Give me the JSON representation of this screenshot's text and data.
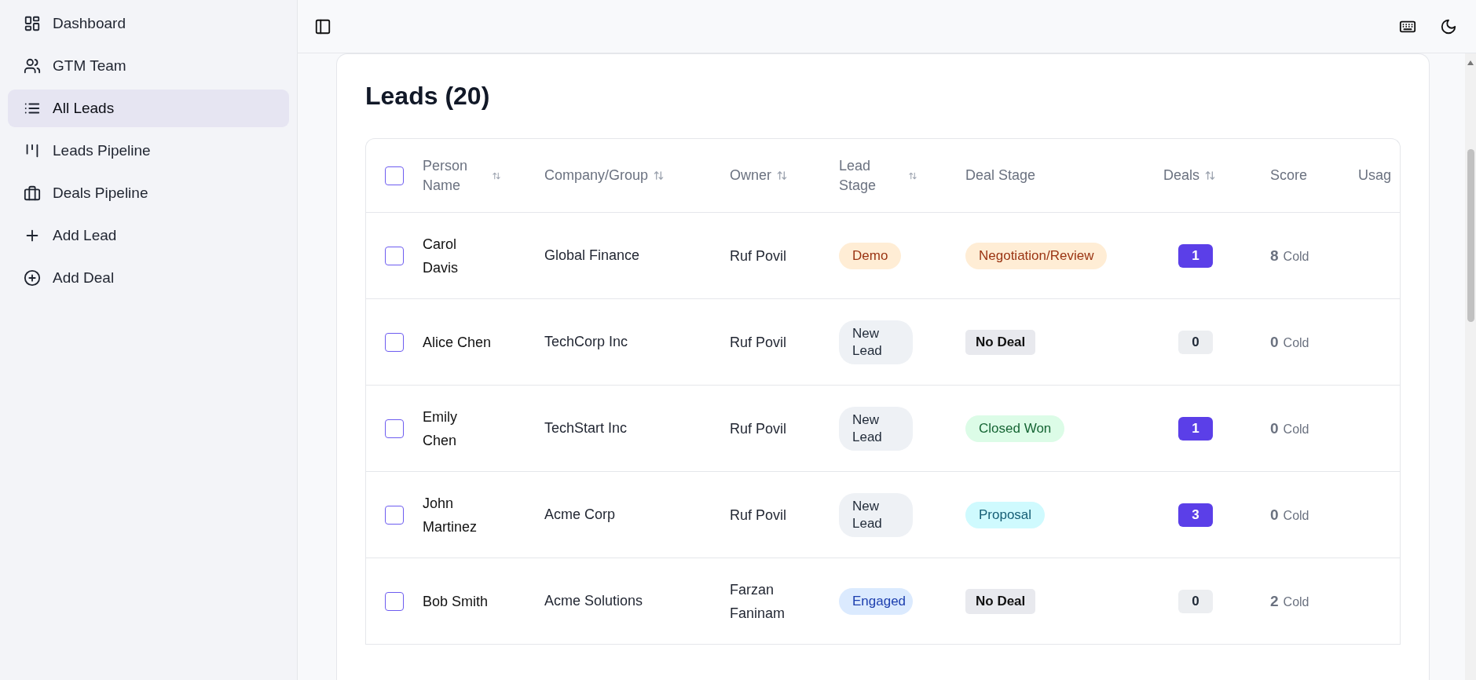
{
  "sidebar": {
    "items": [
      {
        "label": "Dashboard",
        "selected": false
      },
      {
        "label": "GTM Team",
        "selected": false
      },
      {
        "label": "All Leads",
        "selected": true
      },
      {
        "label": "Leads Pipeline",
        "selected": false
      },
      {
        "label": "Deals Pipeline",
        "selected": false
      },
      {
        "label": "Add Lead",
        "selected": false
      },
      {
        "label": "Add Deal",
        "selected": false
      }
    ]
  },
  "card": {
    "title": "Leads (20)"
  },
  "table": {
    "select_all_checked": false,
    "columns": [
      {
        "label": "Person Name",
        "sortable": true
      },
      {
        "label": "Company/Group",
        "sortable": true
      },
      {
        "label": "Owner",
        "sortable": true
      },
      {
        "label": "Lead Stage",
        "sortable": true
      },
      {
        "label": "Deal Stage",
        "sortable": false
      },
      {
        "label": "Deals",
        "sortable": true
      },
      {
        "label": "Score",
        "sortable": false
      },
      {
        "label": "Usag",
        "sortable": false
      }
    ],
    "rows": [
      {
        "checked": false,
        "name": "Carol Davis",
        "company": "Global Finance",
        "owner": "Ruf Povil",
        "lead_stage": {
          "label": "Demo",
          "color": "#ffedd5"
        },
        "deal_stage": {
          "label": "Negotiation/Review",
          "color": "#ffedd5"
        },
        "deals": {
          "label": "1",
          "color": "#5b3fe8"
        },
        "score": "8",
        "temperature": "Cold"
      },
      {
        "checked": false,
        "name": "Alice Chen",
        "company": "TechCorp Inc",
        "owner": "Ruf Povil",
        "lead_stage": {
          "label": "New Lead",
          "color": "#eef1f5"
        },
        "deal_stage": {
          "label": "No Deal",
          "color": "#e8e9ee"
        },
        "deals": {
          "label": "0",
          "color": "#eceef1"
        },
        "score": "0",
        "temperature": "Cold"
      },
      {
        "checked": false,
        "name": "Emily Chen",
        "company": "TechStart Inc",
        "owner": "Ruf Povil",
        "lead_stage": {
          "label": "New Lead",
          "color": "#eef1f5"
        },
        "deal_stage": {
          "label": "Closed Won",
          "color": "#dcfce7"
        },
        "deals": {
          "label": "1",
          "color": "#5b3fe8"
        },
        "score": "0",
        "temperature": "Cold"
      },
      {
        "checked": false,
        "name": "John Martinez",
        "company": "Acme Corp",
        "owner": "Ruf Povil",
        "lead_stage": {
          "label": "New Lead",
          "color": "#eef1f5"
        },
        "deal_stage": {
          "label": "Proposal",
          "color": "#cffafe"
        },
        "deals": {
          "label": "3",
          "color": "#5b3fe8"
        },
        "score": "0",
        "temperature": "Cold"
      },
      {
        "checked": false,
        "name": "Bob Smith",
        "company": "Acme Solutions",
        "owner": "Farzan Faninam",
        "lead_stage": {
          "label": "Engaged",
          "color": "#dbeafe"
        },
        "deal_stage": {
          "label": "No Deal",
          "color": "#e8e9ee"
        },
        "deals": {
          "label": "0",
          "color": "#eceef1"
        },
        "score": "2",
        "temperature": "Cold"
      }
    ]
  }
}
